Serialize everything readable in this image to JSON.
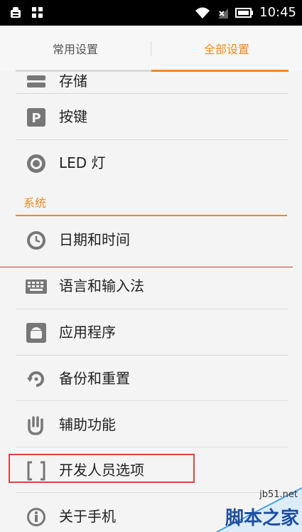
{
  "status_bar": {
    "time": "10:45",
    "icons": [
      "android-debug-icon",
      "app-grid-icon",
      "wifi-icon",
      "no-signal-icon",
      "battery-icon"
    ]
  },
  "tabs": [
    {
      "label": "常用设置",
      "active": false
    },
    {
      "label": "全部设置",
      "active": true
    }
  ],
  "items": [
    {
      "label": "存储",
      "icon": "storage-icon"
    },
    {
      "label": "按键",
      "icon": "key-p-icon"
    },
    {
      "label": "LED 灯",
      "icon": "led-light-icon"
    }
  ],
  "section": {
    "title": "系统"
  },
  "system_items": [
    {
      "label": "日期和时间",
      "icon": "clock-icon"
    },
    {
      "label": "语言和输入法",
      "icon": "keyboard-icon"
    },
    {
      "label": "应用程序",
      "icon": "android-app-icon"
    },
    {
      "label": "备份和重置",
      "icon": "backup-reset-icon"
    },
    {
      "label": "辅助功能",
      "icon": "hand-icon"
    },
    {
      "label": "开发人员选项",
      "icon": "brackets-icon"
    },
    {
      "label": "关于手机",
      "icon": "info-icon"
    }
  ],
  "watermark": {
    "site": "jb51.net",
    "name": "脚本之家"
  },
  "colors": {
    "accent": "#f28a1f",
    "highlight_border": "#e04343",
    "separator_red": "#c0392b"
  }
}
